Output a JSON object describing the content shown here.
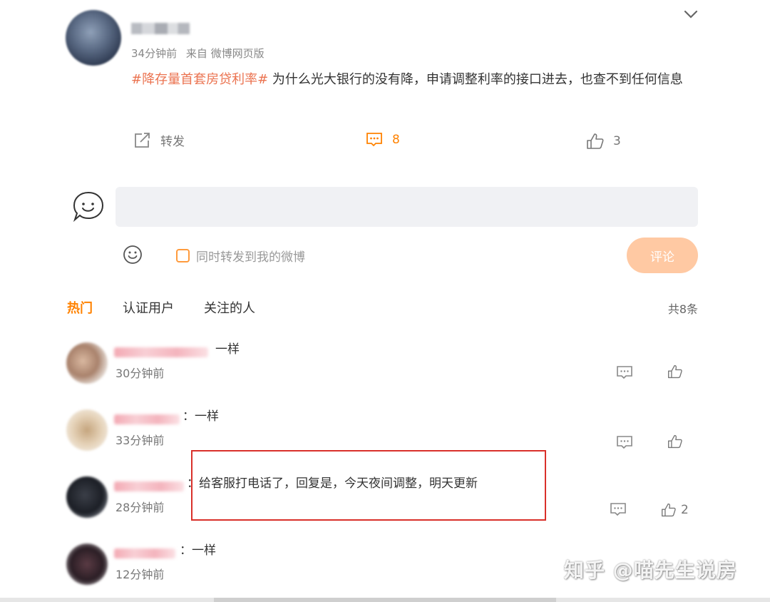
{
  "post": {
    "time": "34分钟前",
    "source": "来自 微博网页版",
    "hashtag": "#降存量首套房贷利率#",
    "text": " 为什么光大银行的没有降，申请调整利率的接口进去，也查不到任何信息",
    "actions": {
      "repost_label": "转发",
      "comment_count": "8",
      "like_count": "3"
    }
  },
  "composer": {
    "placeholder": "",
    "repost_label": "同时转发到我的微博",
    "submit_label": "评论"
  },
  "tabs": [
    {
      "label": "热门"
    },
    {
      "label": "认证用户"
    },
    {
      "label": "关注的人"
    }
  ],
  "total_label": "共8条",
  "comments": [
    {
      "text": "一样",
      "time": "30分钟前",
      "likes": ""
    },
    {
      "text": "：一样",
      "time": "33分钟前",
      "likes": ""
    },
    {
      "text": "：给客服打电话了，回复是，今天夜间调整，明天更新",
      "time": "28分钟前",
      "likes": "2"
    },
    {
      "text": "：一样",
      "time": "12分钟前",
      "likes": ""
    }
  ],
  "watermark": "知乎 @喵先生说房",
  "colors": {
    "accent": "#ff8200",
    "hashtag": "#eb7350",
    "highlight": "#d9302a"
  }
}
